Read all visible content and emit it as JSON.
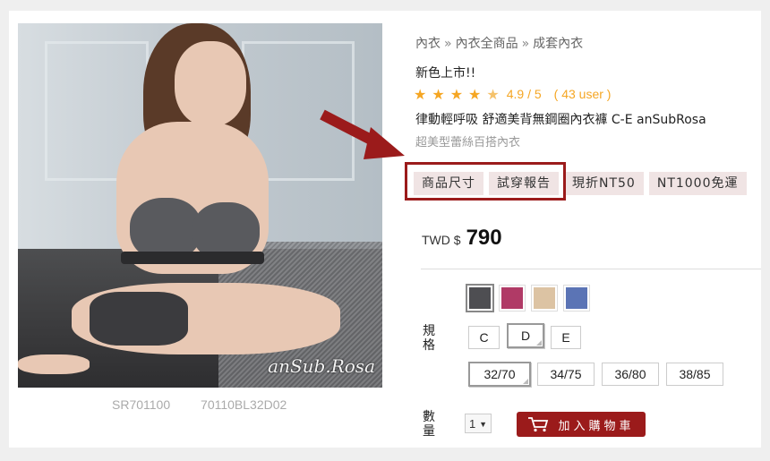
{
  "product": {
    "codes": [
      "SR701100",
      "70110BL32D02"
    ],
    "photo_logo": "anSub.Rosa"
  },
  "breadcrumb": [
    "內衣",
    "內衣全商品",
    "成套內衣"
  ],
  "breadcrumb_sep": "»",
  "promo_text": "新色上市!!",
  "rating": {
    "stars": 4.5,
    "value": "4.9",
    "max": "/ 5",
    "count": "( 43 user )"
  },
  "name": "律動輕呼吸 舒適美背無鋼圈內衣褲 C-E anSubRosa",
  "subtitle": "超美型蕾絲百搭內衣",
  "tags": [
    "商品尺寸",
    "試穿報告",
    "現折NT50",
    "NT1000免運"
  ],
  "price": {
    "currency": "TWD $",
    "amount": "790"
  },
  "colors": [
    "#4e4e52",
    "#b03a66",
    "#dcc3a3",
    "#5b74b5"
  ],
  "spec_label": "規格",
  "cup_sizes": {
    "options": [
      "C",
      "D",
      "E"
    ],
    "selected": "D"
  },
  "band_sizes": {
    "options": [
      "32/70",
      "34/75",
      "36/80",
      "38/85"
    ],
    "selected": "32/70"
  },
  "qty_label": "數量",
  "qty_value": "1",
  "add_to_cart": "加入購物車",
  "accent": "#9b1b1b"
}
